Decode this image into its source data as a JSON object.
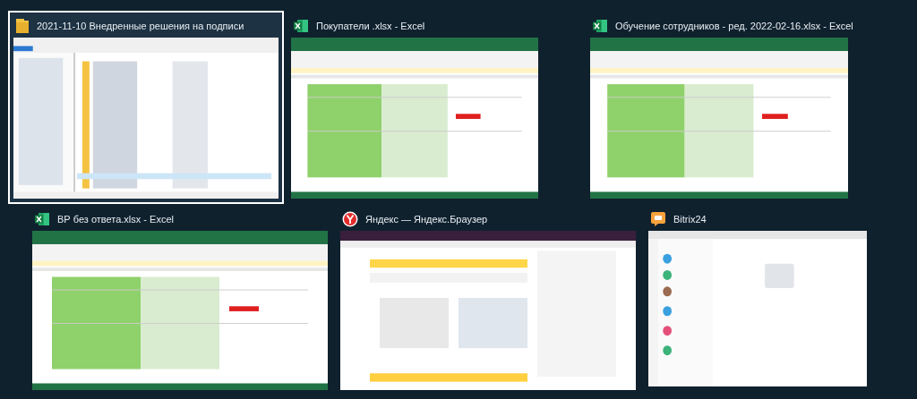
{
  "windows": [
    {
      "title": "2021-11-10 Внедренные решения на подписи",
      "kind": "explorer",
      "selected": true
    },
    {
      "title": "Покупатели .xlsx - Excel",
      "kind": "excel",
      "selected": false
    },
    {
      "title": "Обучение сотрудников - ред. 2022-02-16.xlsx - Excel",
      "kind": "excel",
      "selected": false
    },
    {
      "title": "ВР без ответа.xlsx - Excel",
      "kind": "excel",
      "selected": false
    },
    {
      "title": "Яндекс — Яндекс.Браузер",
      "kind": "browser",
      "selected": false
    },
    {
      "title": "Bitrix24",
      "kind": "messenger",
      "selected": false
    }
  ]
}
